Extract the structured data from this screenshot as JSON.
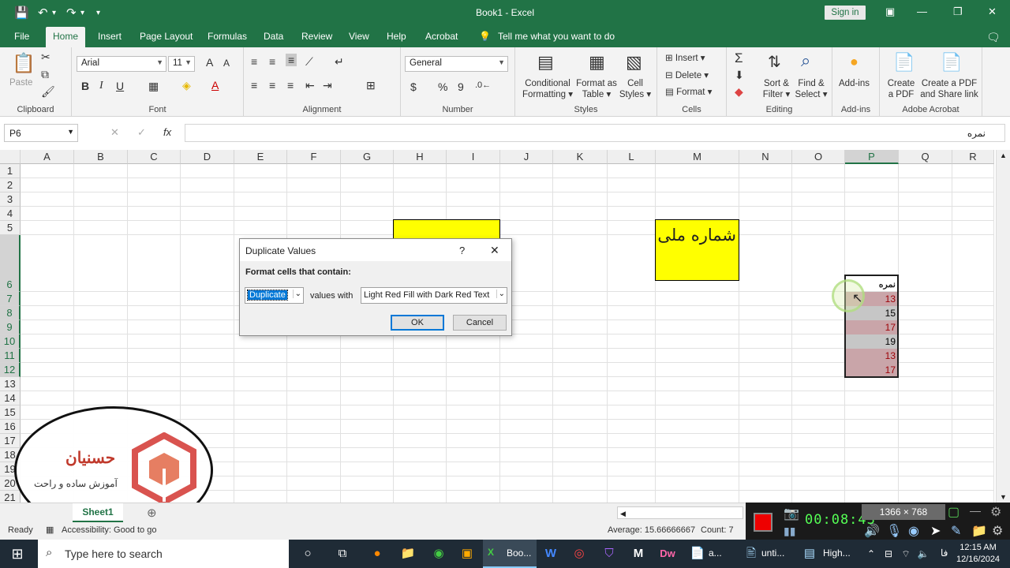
{
  "window": {
    "title": "Book1  -  Excel",
    "signin": "Sign in"
  },
  "tabs": [
    "File",
    "Home",
    "Insert",
    "Page Layout",
    "Formulas",
    "Data",
    "Review",
    "View",
    "Help",
    "Acrobat"
  ],
  "tell_me": "Tell me what you want to do",
  "ribbon": {
    "clipboard": {
      "label": "Clipboard",
      "paste": "Paste"
    },
    "font": {
      "label": "Font",
      "name": "Arial",
      "size": "11",
      "bold": "B",
      "italic": "I",
      "underline": "U"
    },
    "alignment": {
      "label": "Alignment"
    },
    "number": {
      "label": "Number",
      "format": "General",
      "currency": "$",
      "percent": "%",
      "comma": "9"
    },
    "styles": {
      "label": "Styles",
      "conditional": "Conditional",
      "conditional2": "Formatting",
      "format_table": "Format as",
      "format_table2": "Table",
      "cell_styles": "Cell",
      "cell_styles2": "Styles"
    },
    "cells": {
      "label": "Cells",
      "insert": "Insert",
      "delete": "Delete",
      "format": "Format"
    },
    "editing": {
      "label": "Editing",
      "sort": "Sort &",
      "sort2": "Filter",
      "find": "Find &",
      "find2": "Select"
    },
    "addins": {
      "label": "Add-ins",
      "addins": "Add-ins"
    },
    "acrobat": {
      "label": "Adobe Acrobat",
      "create_pdf": "Create",
      "create_pdf2": "a PDF",
      "share": "Create a PDF",
      "share2": "and Share link"
    }
  },
  "formula_bar": {
    "name_box": "P6",
    "fx": "fx",
    "content": "نمره"
  },
  "columns": [
    "A",
    "B",
    "C",
    "D",
    "E",
    "F",
    "G",
    "H",
    "I",
    "J",
    "K",
    "L",
    "M",
    "N",
    "O",
    "P",
    "Q",
    "R"
  ],
  "rows": [
    "1",
    "2",
    "3",
    "4",
    "5",
    "6",
    "7",
    "8",
    "9",
    "10",
    "11",
    "12",
    "13",
    "14",
    "15",
    "16",
    "17",
    "18",
    "19",
    "20",
    "21"
  ],
  "cells": {
    "m5": "شماره ملی",
    "p6": "نمره",
    "p_values": [
      "13",
      "15",
      "17",
      "19",
      "13",
      "17"
    ],
    "p_duplicate": [
      true,
      false,
      true,
      false,
      true,
      true
    ]
  },
  "dialog": {
    "title": "Duplicate Values",
    "help": "?",
    "close": "✕",
    "prompt": "Format cells that contain:",
    "rule": "Duplicate",
    "values_with": "values with",
    "format": "Light Red Fill with Dark Red Text",
    "ok": "OK",
    "cancel": "Cancel"
  },
  "sheet": {
    "tab": "Sheet1"
  },
  "status": {
    "ready": "Ready",
    "accessibility": "Accessibility: Good to go",
    "average": "Average: 15.66666667",
    "count": "Count: 7"
  },
  "recorder": {
    "time": "00:08:43",
    "resolution": "1366 × 768"
  },
  "logo": {
    "brand": "حسنیان",
    "tagline": "آموزش ساده و راحت"
  },
  "taskbar": {
    "search": "Type here to search",
    "excel_app": "Boo...",
    "untitled": "unti...",
    "high": "High...",
    "lang": "فا",
    "time": "12:15 AM",
    "date": "12/16/2024"
  },
  "colors": {
    "excel_green": "#217346",
    "yellow": "#ffff00",
    "dup_fill": "#c9a5a9",
    "dup_text": "#9c0006",
    "unique_fill": "#c6c6c6"
  }
}
